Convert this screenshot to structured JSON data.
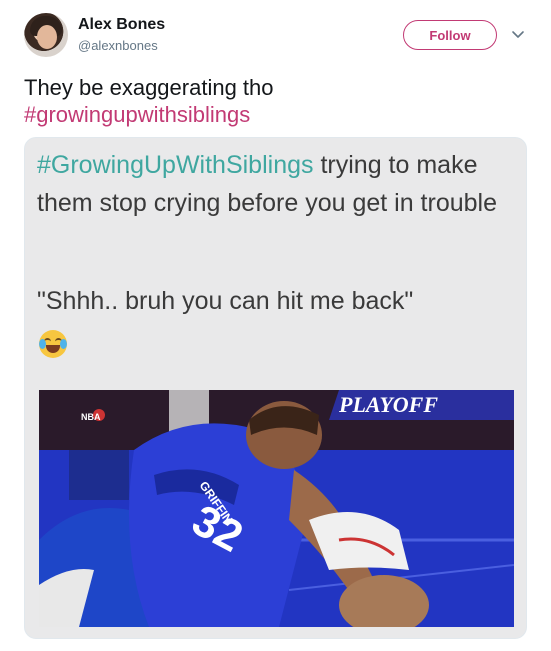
{
  "user": {
    "display_name": "Alex Bones",
    "handle": "@alexnbones",
    "avatar_icon": "avatar-photo"
  },
  "follow_label": "Follow",
  "caret_icon": "chevron-down-icon",
  "tweet": {
    "text": "They be exaggerating tho",
    "hashtag": "#growingupwithsiblings"
  },
  "meme": {
    "hashtag": "#GrowingUpWithSiblings",
    "caption": " trying to make them stop crying before you get in trouble",
    "quote": "\"Shhh.. bruh you can hit me back\"",
    "emoji_icon": "face-with-tears-of-joy-icon",
    "photo": {
      "banner_text": "PLAYOFF",
      "jersey_name": "GRIFFIN",
      "jersey_number": "32",
      "logo_text": "NBA"
    }
  },
  "colors": {
    "accent": "#c23a74",
    "meme_hashtag": "#3fa7a0",
    "court_blue": "#2437c9"
  }
}
